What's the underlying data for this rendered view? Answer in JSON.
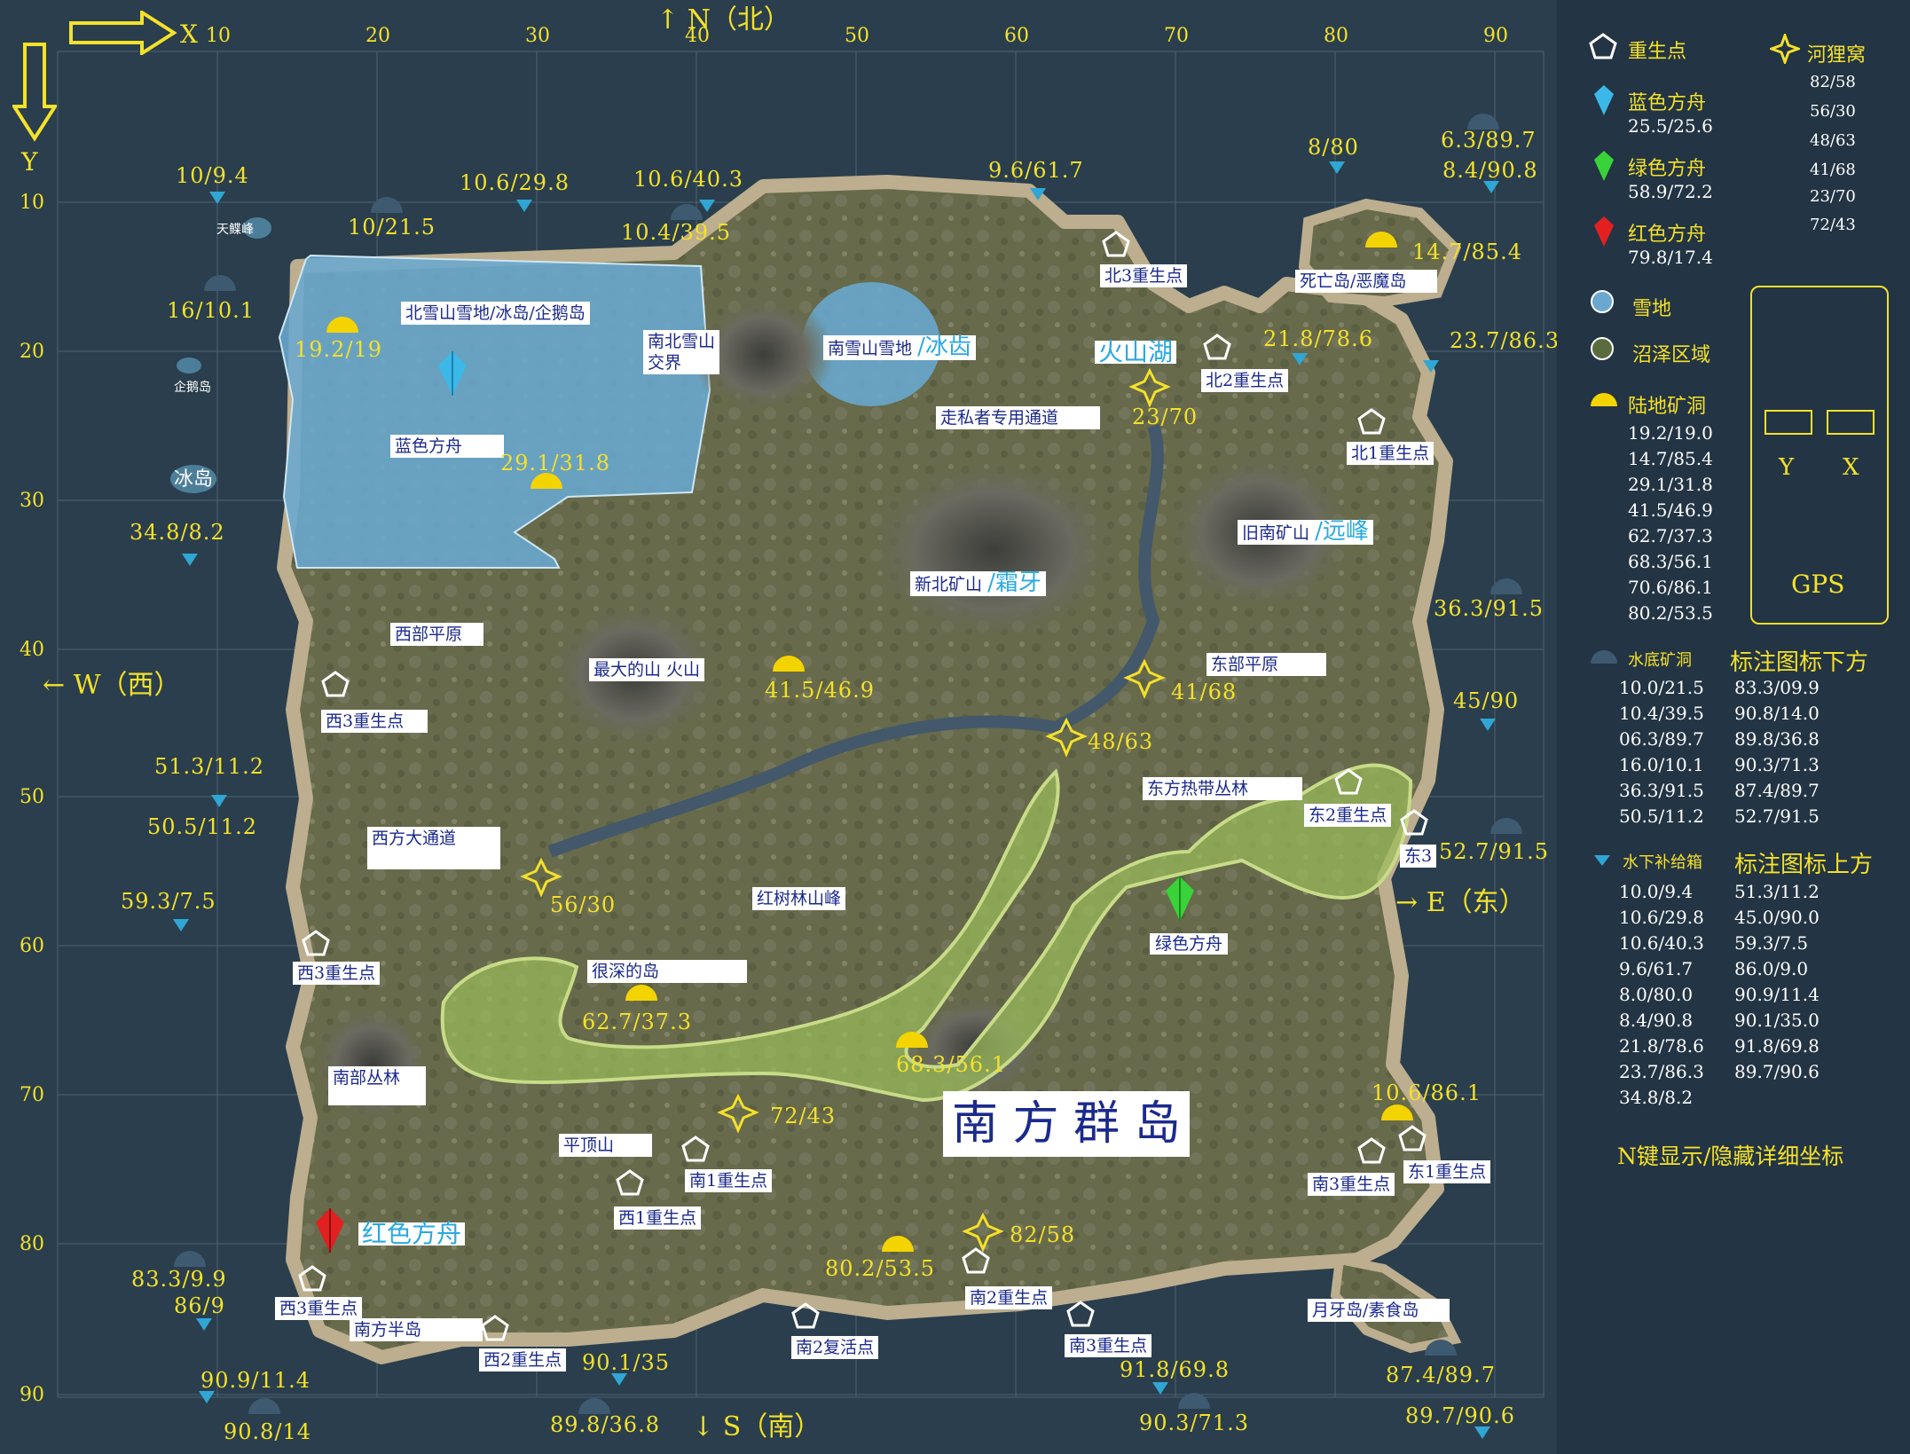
{
  "compass": {
    "x": "X",
    "y": "Y",
    "north": "N（北）",
    "south": "S（南）",
    "west": "W（西）",
    "east": "E（东）"
  },
  "axis": {
    "x_ticks": [
      "10",
      "20",
      "30",
      "40",
      "50",
      "60",
      "70",
      "80",
      "90"
    ],
    "y_ticks": [
      "10",
      "20",
      "30",
      "40",
      "50",
      "60",
      "70",
      "80",
      "90"
    ]
  },
  "regions": {
    "north_snow": "北雪山雪地/冰岛/企鹅岛",
    "south_north_snow_1": "南北雪山",
    "south_north_snow_2": "交界",
    "south_snow": "南雪山雪地",
    "ice_tooth": "/冰齿",
    "volcano_lake": "火山湖",
    "smuggler": "走私者专用通道",
    "blue_ark": "蓝色方舟",
    "old_south_mine": "旧南矿山",
    "far_peak": "/远峰",
    "new_north_mine": "新北矿山",
    "frost_tooth": "/霜牙",
    "west_plain": "西部平原",
    "biggest_mountain": "最大的山 火山",
    "east_plain": "东部平原",
    "east_jungle": "东方热带丛林",
    "west_passage": "西方大通道",
    "mangrove_peak": "红树林山峰",
    "green_ark": "绿色方舟",
    "deep_island": "很深的岛",
    "south_jungle": "南部丛林",
    "south_islands": "南 方 群 岛",
    "flat_mountain": "平顶山",
    "red_ark": "红色方舟",
    "south_peninsula": "南方半岛",
    "death_island": "死亡岛/恶魔岛",
    "moon_island": "月牙岛/素食岛",
    "sky_peak": "天鲽峰",
    "penguin_island": "企鹅岛",
    "ice_island": "冰岛"
  },
  "respawns": {
    "north3": "北3重生点",
    "north2": "北2重生点",
    "north1": "北1重生点",
    "west3a": "西3重生点",
    "west3b": "西3重生点",
    "west3c": "西3重生点",
    "east2": "东2重生点",
    "east3": "东3",
    "south1": "南1重生点",
    "west1": "西1重生点",
    "south3a": "南3重生点",
    "east1": "东1重生点",
    "south2": "南2重生点",
    "south2_revive": "南2复活点",
    "south3b": "南3重生点",
    "west2": "西2重生点"
  },
  "coords": {
    "c1": "10/9.4",
    "c2": "10.6/29.8",
    "c3": "10.6/40.3",
    "c4": "9.6/61.7",
    "c5": "8/80",
    "c6": "6.3/89.7",
    "c7": "8.4/90.8",
    "c8": "10/21.5",
    "c9": "10.4/39.5",
    "c10": "14.7/85.4",
    "c11": "16/10.1",
    "c12": "19.2/19",
    "c13": "21.8/78.6",
    "c14": "23.7/86.3",
    "c15": "23/70",
    "c16": "29.1/31.8",
    "c17": "34.8/8.2",
    "c18": "36.3/91.5",
    "c19": "41.5/46.9",
    "c20": "41/68",
    "c21": "45/90",
    "c22": "48/63",
    "c23": "51.3/11.2",
    "c24": "50.5/11.2",
    "c25": "52.7/91.5",
    "c26": "59.3/7.5",
    "c27": "56/30",
    "c28": "62.7/37.3",
    "c29": "68.3/56.1",
    "c30": "72/43",
    "c31": "10.6/86.1",
    "c32": "82/58",
    "c33": "80.2/53.5",
    "c34": "83.3/9.9",
    "c35": "86/9",
    "c36": "90.9/11.4",
    "c37": "90.8/14",
    "c38": "90.1/35",
    "c39": "89.8/36.8",
    "c40": "91.8/69.8",
    "c41": "90.3/71.3",
    "c42": "87.4/89.7",
    "c43": "89.7/90.6"
  },
  "legend": {
    "respawn": "重生点",
    "den": "河狸窝",
    "den_list": [
      "82/58",
      "56/30",
      "48/63",
      "41/68",
      "23/70",
      "72/43"
    ],
    "blue_ark": "蓝色方舟",
    "blue_ark_pos": "25.5/25.6",
    "green_ark": "绿色方舟",
    "green_ark_pos": "58.9/72.2",
    "red_ark": "红色方舟",
    "red_ark_pos": "79.8/17.4",
    "snow": "雪地",
    "swamp": "沼泽区域",
    "land_cave": "陆地矿洞",
    "land_cave_list": [
      "19.2/19.0",
      "14.7/85.4",
      "29.1/31.8",
      "41.5/46.9",
      "62.7/37.3",
      "68.3/56.1",
      "70.6/86.1",
      "80.2/53.5"
    ],
    "gps": "GPS",
    "gps_y": "Y",
    "gps_x": "X",
    "water_cave": "水底矿洞",
    "water_cave_note": "标注图标下方",
    "water_cave_col1": [
      "10.0/21.5",
      "10.4/39.5",
      "06.3/89.7",
      "16.0/10.1",
      "36.3/91.5",
      "50.5/11.2"
    ],
    "water_cave_col2": [
      "83.3/09.9",
      "90.8/14.0",
      "89.8/36.8",
      "90.3/71.3",
      "87.4/89.7",
      "52.7/91.5"
    ],
    "supply": "水下补给箱",
    "supply_note": "标注图标上方",
    "supply_col1": [
      "10.0/9.4",
      "10.6/29.8",
      "10.6/40.3",
      "9.6/61.7",
      "8.0/80.0",
      "8.4/90.8",
      "21.8/78.6",
      "23.7/86.3",
      "34.8/8.2"
    ],
    "supply_col2": [
      "51.3/11.2",
      "45.0/90.0",
      "59.3/7.5",
      "86.0/9.0",
      "90.9/11.4",
      "90.1/35.0",
      "91.8/69.8",
      "89.7/90.6"
    ],
    "toggle": "N键显示/隐藏详细坐标"
  },
  "colors": {
    "yellow": "#f4e12a",
    "snow": "#6aa8d0",
    "swamp": "#9bbd5a",
    "sea": "#2a3e4d",
    "land": "#6a6b4a"
  }
}
